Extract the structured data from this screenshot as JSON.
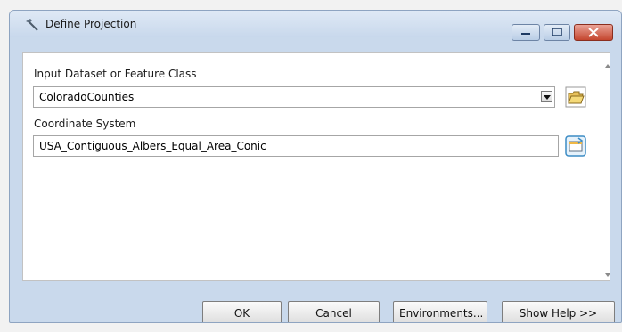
{
  "window": {
    "title": "Define Projection",
    "title_icon": "hammer-icon"
  },
  "fields": {
    "input_dataset": {
      "label": "Input Dataset or Feature Class",
      "value": "ColoradoCounties",
      "browse_icon": "open-folder-icon"
    },
    "coordinate_system": {
      "label": "Coordinate System",
      "value": "USA_Contiguous_Albers_Equal_Area_Conic",
      "properties_icon": "spatial-reference-properties-icon"
    }
  },
  "buttons": {
    "ok": "OK",
    "cancel": "Cancel",
    "environments": "Environments...",
    "show_help": "Show Help >>"
  },
  "colors": {
    "title_bar": "#c9d9ec",
    "close_button": "#c4462f",
    "content_background": "#ffffff"
  }
}
